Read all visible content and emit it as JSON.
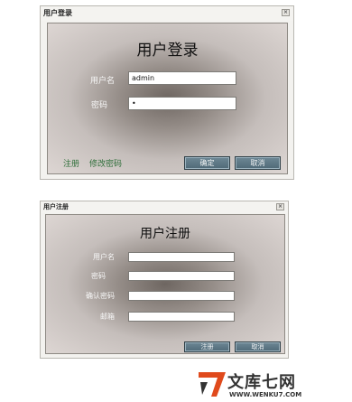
{
  "login": {
    "window_title": "用户登录",
    "heading": "用户登录",
    "username_label": "用户名",
    "username_value": "admin",
    "password_label": "密码",
    "password_value": "•",
    "register_link": "注册",
    "change_password_link": "修改密码",
    "ok_button": "确定",
    "cancel_button": "取消"
  },
  "register": {
    "window_title": "用户注册",
    "heading": "用户注册",
    "username_label": "用户名",
    "password_label": "密码",
    "confirm_password_label": "确认密码",
    "email_label": "邮箱",
    "submit_button": "注册",
    "cancel_button": "取消"
  },
  "watermark": {
    "name": "文库七网",
    "url": "WWW.WENKU7.COM"
  },
  "colors": {
    "button": "#5b7583",
    "link": "#2f6f3a",
    "watermark_mark": "#e04a1c"
  }
}
